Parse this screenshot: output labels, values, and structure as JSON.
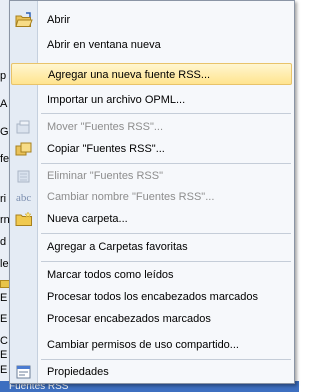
{
  "background": {
    "fragments": [
      "p",
      "A",
      "G",
      "fe",
      "ri",
      "rn",
      "d",
      "le",
      "E",
      "E",
      "C",
      "E",
      "E"
    ],
    "bottom_text": "Fuentes RSS"
  },
  "menu": {
    "items": [
      {
        "label": "Abrir",
        "icon": "open-folder-icon",
        "enabled": true
      },
      {
        "label": "Abrir en ventana nueva",
        "icon": "",
        "enabled": true
      },
      {
        "label": "Agregar una nueva fuente RSS...",
        "icon": "",
        "enabled": true,
        "highlighted": true
      },
      {
        "label": "Importar un archivo OPML...",
        "icon": "",
        "enabled": true
      },
      {
        "label": "Mover \"Fuentes RSS\"...",
        "icon": "move-folder-icon",
        "enabled": false
      },
      {
        "label": "Copiar \"Fuentes RSS\"...",
        "icon": "copy-folder-icon",
        "enabled": true
      },
      {
        "label": "Eliminar \"Fuentes RSS\"",
        "icon": "delete-icon",
        "enabled": false
      },
      {
        "label": "Cambiar nombre \"Fuentes RSS\"...",
        "icon": "rename-icon",
        "enabled": false
      },
      {
        "label": "Nueva carpeta...",
        "icon": "new-folder-icon",
        "enabled": true
      },
      {
        "label": "Agregar a Carpetas favoritas",
        "icon": "",
        "enabled": true
      },
      {
        "label": "Marcar todos como leídos",
        "icon": "",
        "enabled": true
      },
      {
        "label": "Procesar todos los encabezados marcados",
        "icon": "",
        "enabled": true
      },
      {
        "label": "Procesar encabezados marcados",
        "icon": "",
        "enabled": true
      },
      {
        "label": "Cambiar permisos de uso compartido...",
        "icon": "",
        "enabled": true
      },
      {
        "label": "Propiedades",
        "icon": "properties-icon",
        "enabled": true
      }
    ]
  },
  "colors": {
    "highlight_top": "#fff6d0",
    "highlight_bottom": "#ffe48f",
    "disabled_text": "#8d8d8d",
    "menu_background": "#f6f8fb"
  }
}
